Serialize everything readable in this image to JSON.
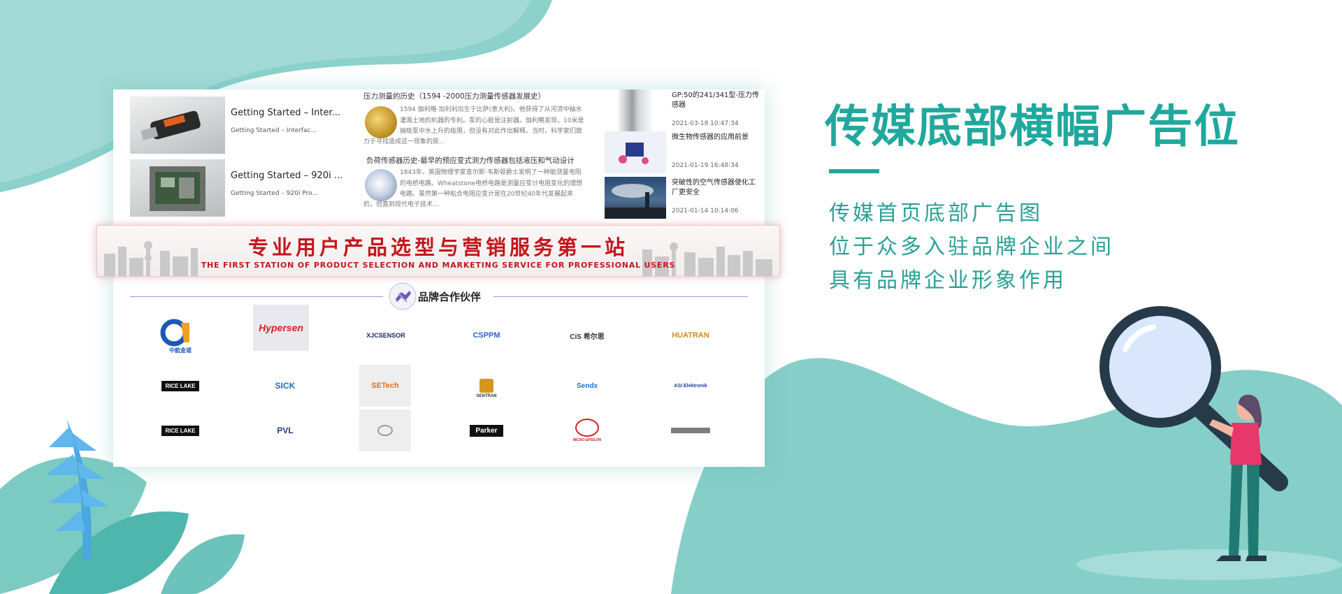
{
  "colors": {
    "accent": "#21a89d",
    "teal_light": "#8cd1cb",
    "banner_red": "#c4161c"
  },
  "news": {
    "col1": [
      {
        "title": "Getting Started – Inter...",
        "sub": "Getting Started – Interfac..."
      },
      {
        "title": "Getting Started – 920i ...",
        "sub": "Getting Started – 920i Pro..."
      }
    ],
    "col2": [
      {
        "title": "压力测量的历史（1594 -2000压力测量传感器发展史）",
        "body": [
          "1594 伽利略·加利利出生于比萨(意大利)。他获得了从河流中抽水",
          "灌溉土地的机器的专利。泵的心脏是注射器。伽利略发现，10米是",
          "抽吸泵中水上升的极限，但没有对此作出解释。当时，科学家们致",
          "力于寻找造成这一现象的原..."
        ]
      },
      {
        "title": "负荷传感器历史-最早的预应变式测力传感器包括液压和气动设计",
        "body": [
          "1843年，英国物理学家查尔斯·韦斯顿爵士发明了一种能测量电阻",
          "的电桥电路。Wheatstone电桥电路是测量应变计电阻变化的理想",
          "电路。虽然第一种粘合电阻应变计是在20世纪40年代发展起来",
          "的，但直到现代电子技术..."
        ]
      }
    ],
    "col3": [
      {
        "title": "GP:50的241/341型-压力传感器",
        "date": "2021-03-18 10:47:34"
      },
      {
        "title": "微生物传感器的应用前景",
        "date": "2021-01-19 16:48:34"
      },
      {
        "title": "突破性的空气传感器使化工厂更安全",
        "date": "2021-01-14 10:14:06"
      }
    ]
  },
  "banner": {
    "main": "专业用户产品选型与营销服务第一站",
    "sub": "THE FIRST STATION OF PRODUCT SELECTION AND MARKETING SERVICE FOR PROFESSIONAL USERS"
  },
  "partners": {
    "title": "品牌合作伙伴",
    "logos": [
      [
        "中航金诺",
        "Hypersen",
        "XJCSENSOR",
        "CSPPM",
        "CiS 希尔思",
        "HUATRAN"
      ],
      [
        "RICE LAKE",
        "SICK",
        "SETech",
        "SENTRAN",
        "Sendx",
        "ASI Elektronik"
      ],
      [
        "RICE LAKE",
        "PVL",
        "",
        "Parker",
        "MICRO-EPSILON",
        ""
      ]
    ]
  },
  "right": {
    "title": "传媒底部横幅广告位",
    "lines": [
      "传媒首页底部广告图",
      "位于众多入驻品牌企业之间",
      "具有品牌企业形象作用"
    ]
  }
}
